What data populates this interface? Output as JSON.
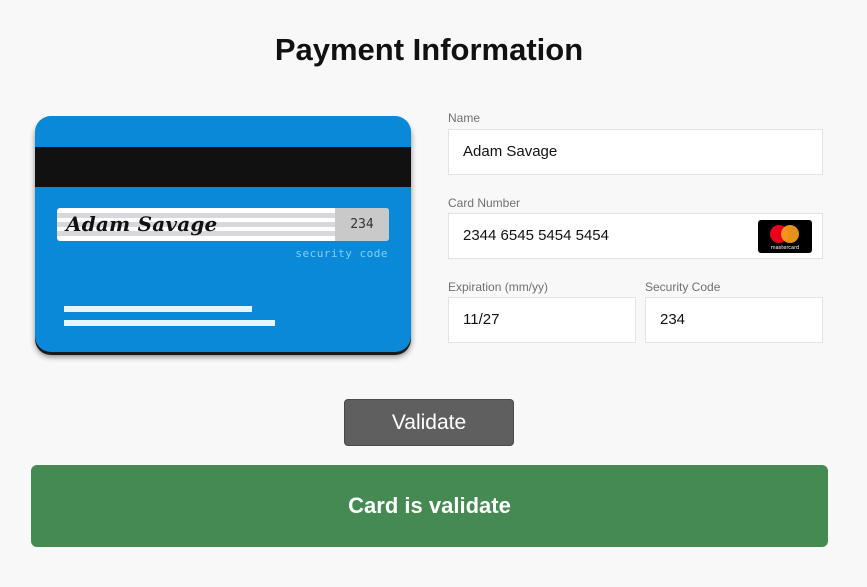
{
  "page": {
    "title": "Payment Information"
  },
  "card_preview": {
    "signature_name": "Adam Savage",
    "cvv": "234",
    "security_label": "security code",
    "brand_text": "mastercard"
  },
  "form": {
    "name": {
      "label": "Name",
      "value": "Adam Savage"
    },
    "card_number": {
      "label": "Card Number",
      "value": "2344 6545 5454 5454"
    },
    "expiration": {
      "label": "Expiration (mm/yy)",
      "value": "11/27"
    },
    "security_code": {
      "label": "Security Code",
      "value": "234"
    }
  },
  "actions": {
    "validate_label": "Validate"
  },
  "status": {
    "message": "Card is validate"
  },
  "colors": {
    "card_blue": "#0a89d8",
    "success_green": "#468a53",
    "button_gray": "#5f5f5f"
  }
}
